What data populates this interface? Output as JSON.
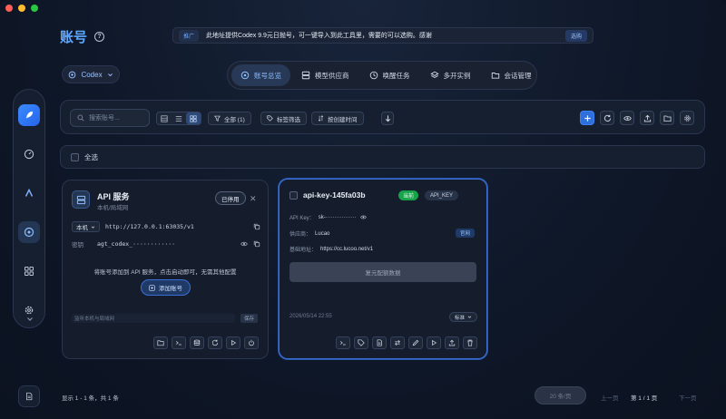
{
  "header": {
    "title": "账号",
    "banner_tag": "推广",
    "banner_text": "此地址提供Codex 9.9元日抛号，可一键导入到此工具里，需要的可以选购。感谢",
    "banner_button": "选购"
  },
  "platform": {
    "label": "Codex"
  },
  "tabs": [
    {
      "label": "账号总览",
      "active": true
    },
    {
      "label": "模型供应商"
    },
    {
      "label": "唤醒任务"
    },
    {
      "label": "多开实例"
    },
    {
      "label": "会话管理"
    }
  ],
  "toolbar": {
    "search_placeholder": "搜索账号...",
    "filter_all": "全部 (1)",
    "tag_filter": "标签筛选",
    "sort": "按创建时间"
  },
  "select_all": "全选",
  "api_card": {
    "title": "API 服务",
    "subtitle": "本机/局域网",
    "status_button": "已停用",
    "scope": "本机",
    "url": "http://127.0.0.1:63035/v1",
    "key_label": "密钥",
    "key_value": "agt_codex_············",
    "hint": "将账号添加到 API 服务，点击启动即可，无需其他配置",
    "add_button": "添加账号",
    "note_placeholder": "监听本机与局域网",
    "save": "保存"
  },
  "key_card": {
    "title": "api-key-145fa03b",
    "badge_current": "当前",
    "badge_type": "API_KEY",
    "api_key_label": "API Key：",
    "api_key_value": "sk-·················",
    "provider_label": "供应商：",
    "provider_value": "Lucao",
    "site_button": "官网",
    "base_label": "基础地址：",
    "base_value": "https://cc.lucoo.net/v1",
    "restore_button": "复元配额数据",
    "date": "2026/05/14 22:55",
    "mode": "标准"
  },
  "footer": {
    "summary": "显示 1 - 1 条，共 1 条",
    "page_size": "20 条/页",
    "prev": "上一页",
    "page_info": "第 1 / 1 页",
    "next": "下一页"
  }
}
